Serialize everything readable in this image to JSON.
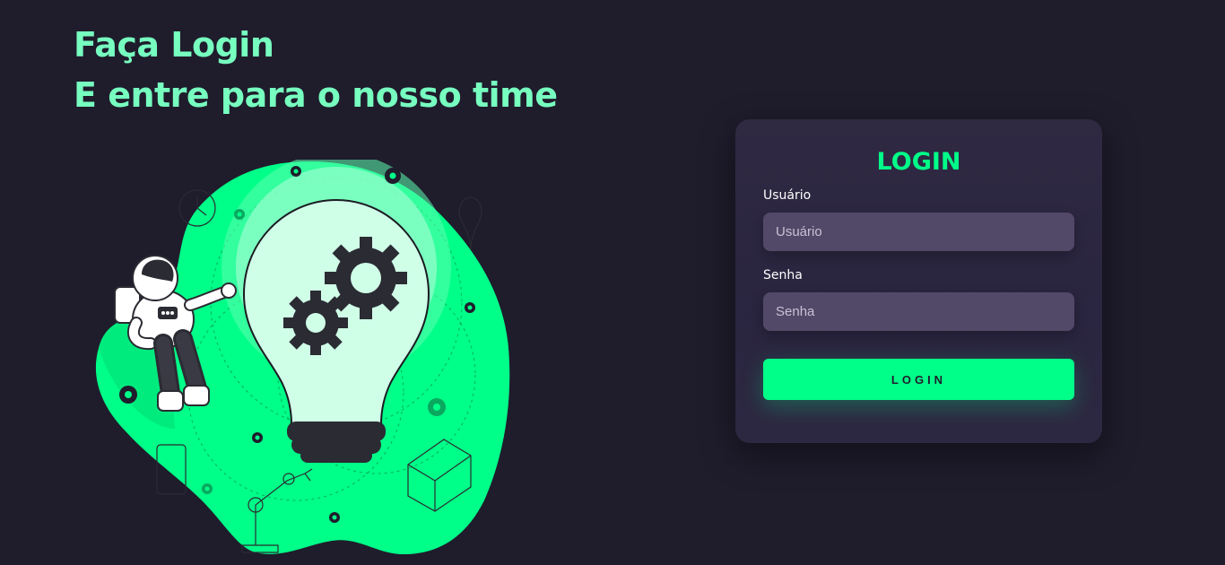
{
  "hero": {
    "line1": "Faça Login",
    "line2": "E entre para o nosso time"
  },
  "illustration": {
    "name": "astronaut-lightbulb-gears-illustration"
  },
  "login_card": {
    "title": "LOGIN",
    "username": {
      "label": "Usuário",
      "value": "",
      "placeholder": "Usuário"
    },
    "password": {
      "label": "Senha",
      "value": "",
      "placeholder": "Senha"
    },
    "submit_label": "LOGIN"
  },
  "colors": {
    "background": "#1f1c2c",
    "card": "#2f2942",
    "input": "#524868",
    "accent": "#00ff88",
    "heading": "#77ffc0"
  }
}
